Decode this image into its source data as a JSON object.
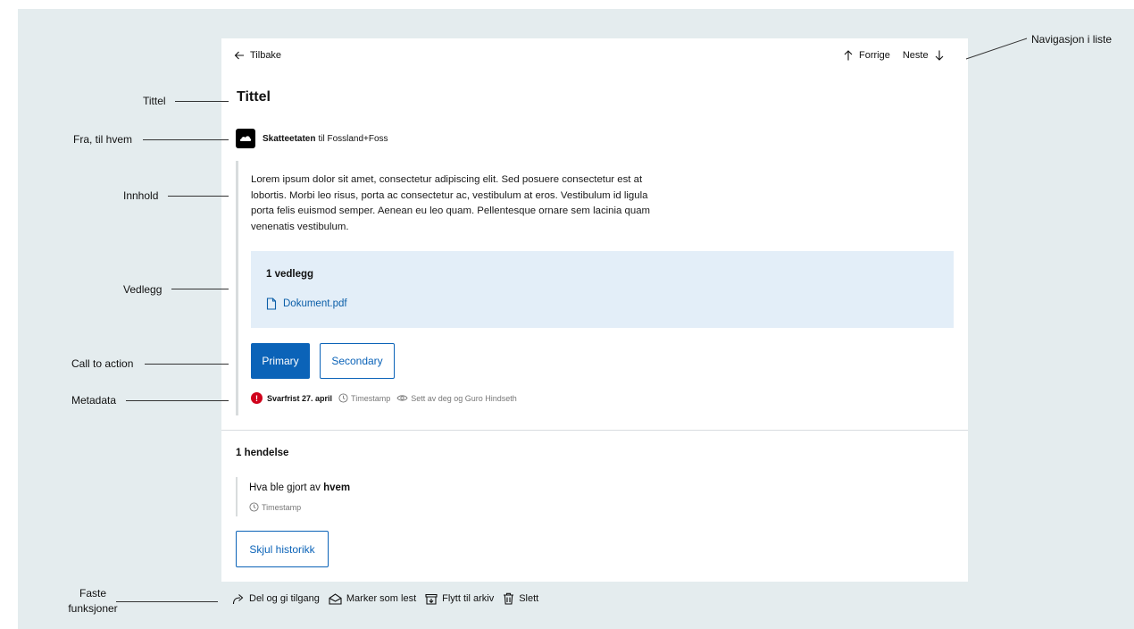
{
  "nav": {
    "back_label": "Tilbake",
    "prev_label": "Forrige",
    "next_label": "Neste"
  },
  "message": {
    "title": "Tittel",
    "sender": "Skatteetaten",
    "recipient_text": "til Fossland+Foss",
    "body": "Lorem ipsum dolor sit amet, consectetur adipiscing elit. Sed posuere consectetur est at lobortis. Morbi leo risus, porta ac consectetur ac, vestibulum at eros. Vestibulum id ligula porta felis euismod semper. Aenean eu leo quam. Pellentesque ornare sem lacinia quam venenatis vestibulum."
  },
  "attachments": {
    "heading": "1 vedlegg",
    "files": [
      "Dokument.pdf"
    ]
  },
  "cta": {
    "primary_label": "Primary",
    "secondary_label": "Secondary"
  },
  "metadata": {
    "alert_symbol": "!",
    "deadline": "Svarfrist 27. april",
    "timestamp": "Timestamp",
    "seen_by": "Sett av deg og Guro Hindseth"
  },
  "history": {
    "heading": "1 hendelse",
    "event_prefix": "Hva ble gjort av",
    "event_actor": "hvem",
    "event_timestamp": "Timestamp",
    "toggle_label": "Skjul historikk"
  },
  "actions": {
    "share_label": "Del og gi tilgang",
    "mark_read_label": "Marker som lest",
    "archive_label": "Flytt til arkiv",
    "delete_label": "Slett"
  },
  "annotations": {
    "title": "Tittel",
    "from_to": "Fra, til hvem",
    "content": "Innhold",
    "attachment": "Vedlegg",
    "cta": "Call to action",
    "metadata": "Metadata",
    "fixed_line1": "Faste",
    "fixed_line2": "funksjoner",
    "list_nav": "Navigasjon i liste"
  },
  "colors": {
    "background": "#e4ecee",
    "primary": "#0b63b8",
    "attachment_bg": "#e3eef8",
    "alert": "#d0021b"
  }
}
